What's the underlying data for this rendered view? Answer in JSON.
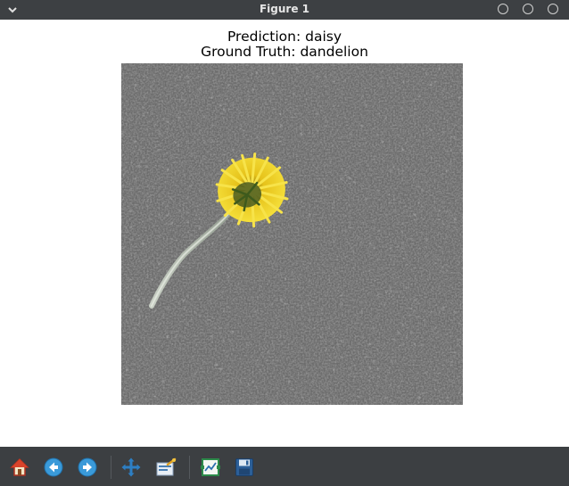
{
  "window": {
    "title": "Figure 1"
  },
  "figure": {
    "title_line1": "Prediction: daisy",
    "title_line2": "Ground Truth: dandelion",
    "image_content": "yellow dandelion flower lying on grey asphalt, black and white background"
  },
  "toolbar": {
    "buttons": [
      {
        "name": "home",
        "icon": "home-icon"
      },
      {
        "name": "back",
        "icon": "arrow-left-icon"
      },
      {
        "name": "forward",
        "icon": "arrow-right-icon"
      },
      {
        "name": "pan",
        "icon": "move-icon"
      },
      {
        "name": "zoom",
        "icon": "zoom-rect-icon"
      },
      {
        "name": "subplots",
        "icon": "subplots-icon"
      },
      {
        "name": "save",
        "icon": "floppy-icon"
      }
    ]
  },
  "colors": {
    "titlebar": "#3d4043",
    "toolbar": "#3c3f42",
    "petal": "#f2d21b",
    "asphalt": "#6e6e6e"
  }
}
